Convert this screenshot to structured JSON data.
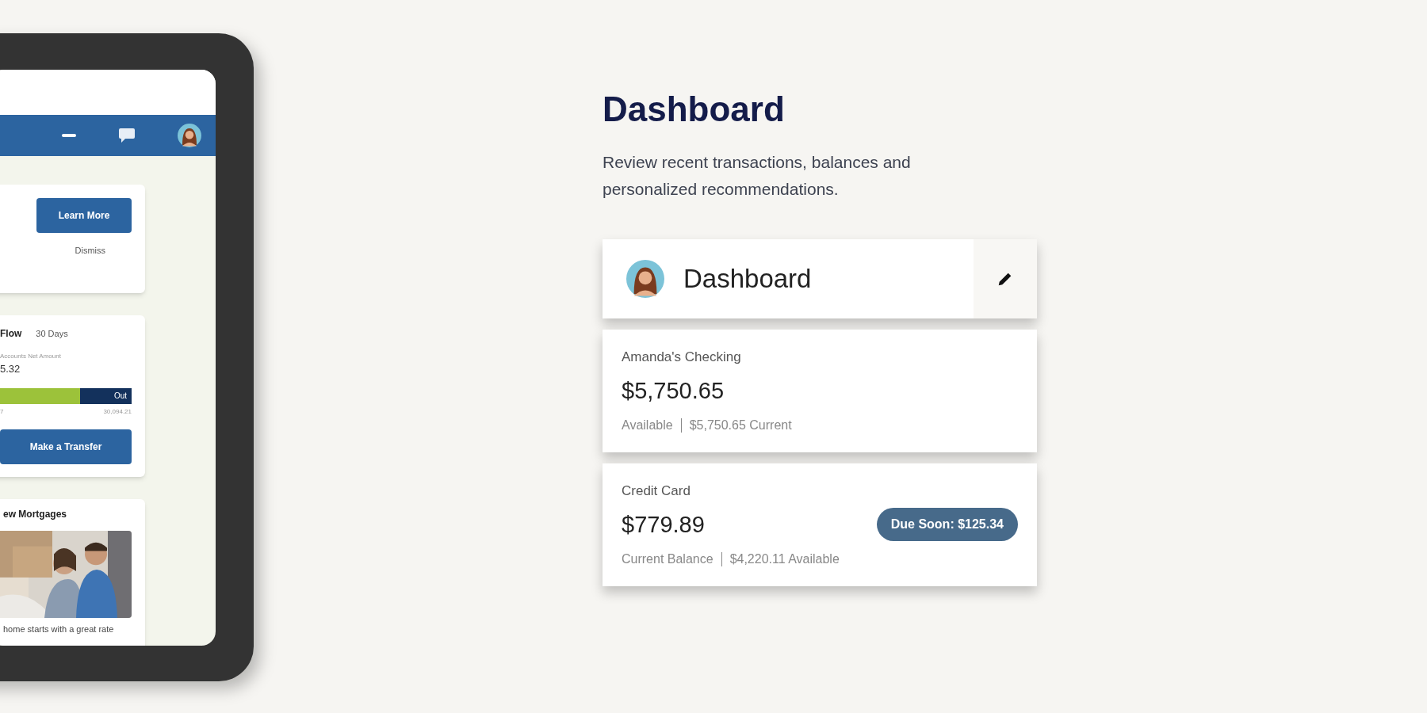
{
  "tablet": {
    "promo_card": {
      "button": "Learn More",
      "dismiss": "Dismiss"
    },
    "cash_flow": {
      "title": "Flow",
      "period": "30 Days",
      "net_label": "Accounts Net Amount",
      "net_value": "5.32",
      "bar": {
        "level": 0.61,
        "out_label": "Out"
      },
      "left_value": "7",
      "right_value": "30,094.21",
      "button": "Make a Transfer"
    },
    "mortgage_card": {
      "title": "ew Mortgages",
      "caption": "home starts with a great rate"
    }
  },
  "heading": "Dashboard",
  "description": "Review recent transactions, balances and personalized recommendations.",
  "widget": {
    "title": "Dashboard",
    "accounts": [
      {
        "name": "Amanda's Checking",
        "amount": "$5,750.65",
        "details": [
          "Available",
          "$5,750.65 Current"
        ]
      },
      {
        "name": "Credit Card",
        "amount": "$779.89",
        "details": [
          "Current Balance",
          "$4,220.11 Available"
        ],
        "badge": "Due Soon: $125.34"
      }
    ]
  }
}
